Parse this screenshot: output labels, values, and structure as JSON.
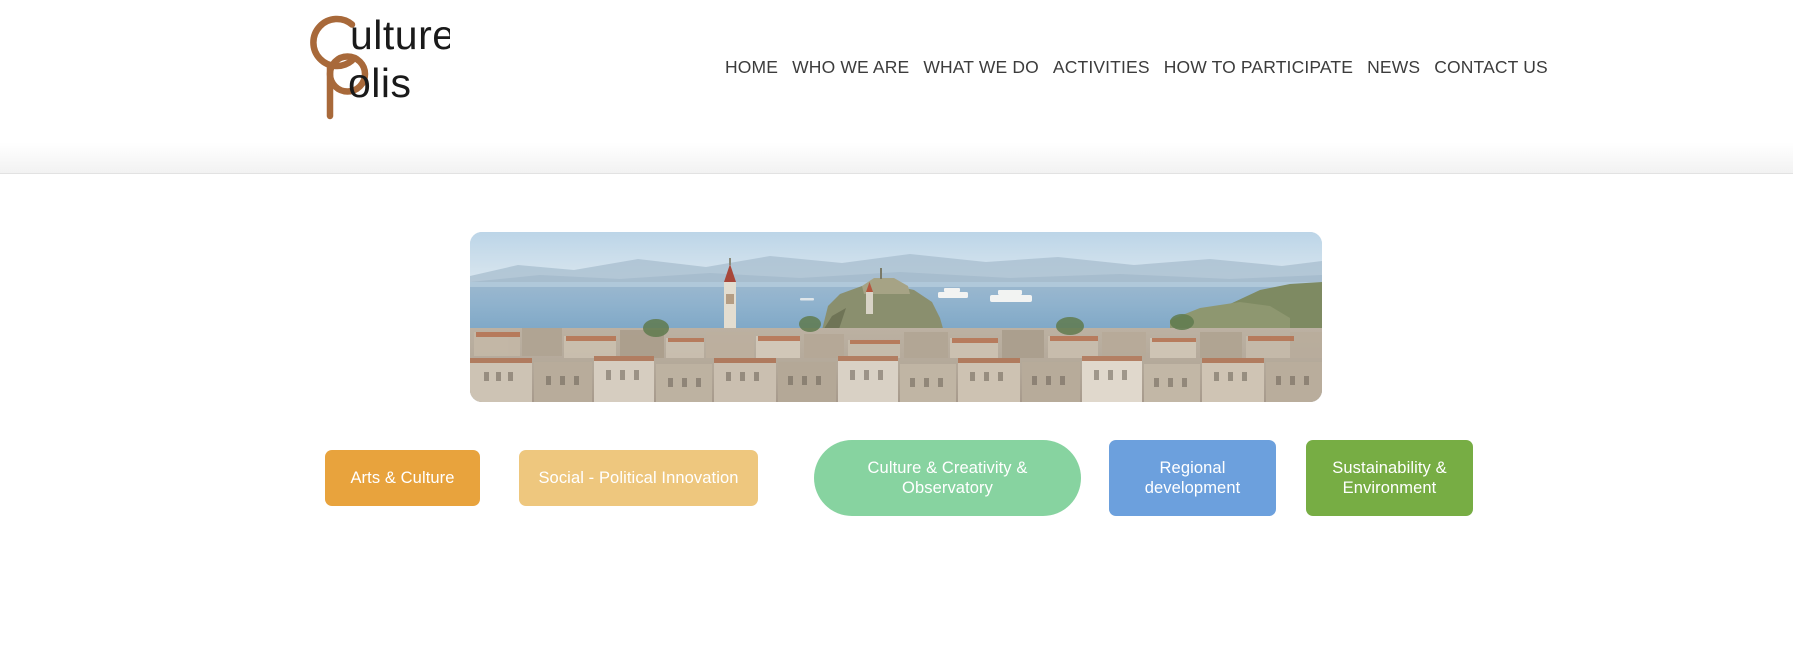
{
  "site": {
    "logo": {
      "name": "culturepolis-logo",
      "line1": "ulture",
      "line2": "olis",
      "initial_c": "C",
      "initial_p": "P",
      "full_text": "CulturePolis",
      "brand_color": "#A8693A",
      "text_color": "#1a1a1a"
    },
    "nav": {
      "items": [
        {
          "label": "HOME",
          "name": "nav-home"
        },
        {
          "label": "WHO WE ARE",
          "name": "nav-who-we-are"
        },
        {
          "label": "WHAT WE DO",
          "name": "nav-what-we-do"
        },
        {
          "label": "ACTIVITIES",
          "name": "nav-activities"
        },
        {
          "label": "HOW TO PARTICIPATE",
          "name": "nav-how-to-participate"
        },
        {
          "label": "NEWS",
          "name": "nav-news"
        },
        {
          "label": "CONTACT US",
          "name": "nav-contact-us"
        }
      ]
    }
  },
  "main": {
    "hero": {
      "name": "hero-panorama-image",
      "alt": "Panoramic view of Corfu old town with fortress, rooftops, sea and cruise ships"
    },
    "categories": [
      {
        "label": "Arts & Culture",
        "color": "#E8A33D",
        "name": "category-arts-culture"
      },
      {
        "label": "Social - Political Innovation",
        "color": "#EEC77E",
        "name": "category-social-political-innovation"
      },
      {
        "label": "Culture & Creativity & Observatory",
        "color": "#87D3A0",
        "name": "category-culture-creativity-observatory"
      },
      {
        "label": "Regional development",
        "color": "#6CA0DD",
        "name": "category-regional-development"
      },
      {
        "label": "Sustainability & Environment",
        "color": "#77AD44",
        "name": "category-sustainability-environment"
      }
    ]
  },
  "colors": {
    "page_background": "#FFFFFF",
    "nav_text": "#3C3C3C",
    "header_band_border": "#E2E2E2"
  }
}
